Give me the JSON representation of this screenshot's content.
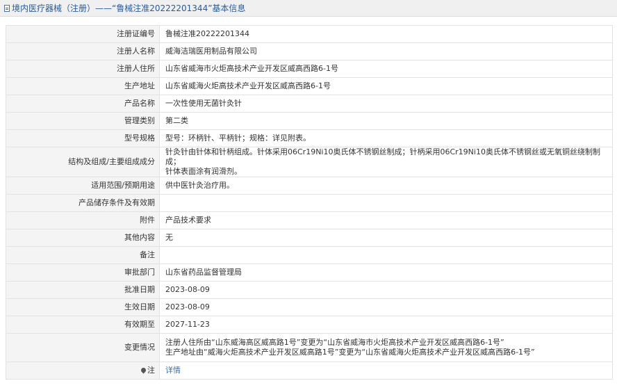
{
  "header": {
    "title": "境内医疗器械（注册）——“鲁械注准20222201344”基本信息"
  },
  "rows": [
    {
      "label": "注册证编号",
      "value": "鲁械注准20222201344"
    },
    {
      "label": "注册人名称",
      "value": "威海洁瑞医用制品有限公司"
    },
    {
      "label": "注册人住所",
      "value": "山东省威海市火炬高技术产业开发区威高西路6-1号"
    },
    {
      "label": "生产地址",
      "value": "山东省威海火炬高技术产业开发区威高西路6-1号"
    },
    {
      "label": "产品名称",
      "value": "一次性使用无菌针灸针"
    },
    {
      "label": "管理类别",
      "value": "第二类"
    },
    {
      "label": "型号规格",
      "value": "型号：环柄针、平柄针；规格：详见附表。"
    },
    {
      "label": "结构及组成/主要组成成分",
      "value_lines": [
        "针灸针由针体和针柄组成。针体采用06Cr19Ni10奥氏体不锈钢丝制成；针柄采用06Cr19Ni10奥氏体不锈钢丝或无氧铜丝绕制制成；",
        "针体表面涂有润滑剂。"
      ]
    },
    {
      "label": "适用范围/预期用途",
      "value": "供中医针灸治疗用。"
    },
    {
      "label": "产品储存条件及有效期",
      "value": ""
    },
    {
      "label": "附件",
      "value": "产品技术要求"
    },
    {
      "label": "其他内容",
      "value": "无"
    },
    {
      "label": "备注",
      "value": ""
    },
    {
      "label": "审批部门",
      "value": "山东省药品监督管理局"
    },
    {
      "label": "批准日期",
      "value": "2023-08-09"
    },
    {
      "label": "生效日期",
      "value": "2023-08-09"
    },
    {
      "label": "有效期至",
      "value": "2027-11-23"
    },
    {
      "label": "变更情况",
      "value_lines": [
        "注册人住所由“山东威海高区威高路1号”变更为“山东省威海市火炬高技术产业开发区威高西路6-1号”",
        "生产地址由“威海火炬高技术产业开发区威高路1号”变更为“山东省威海火炬高技术产业开发区威高西路6-1号”"
      ]
    }
  ],
  "note": {
    "label": "注",
    "link_text": "详情",
    "icon": "pin-icon"
  }
}
